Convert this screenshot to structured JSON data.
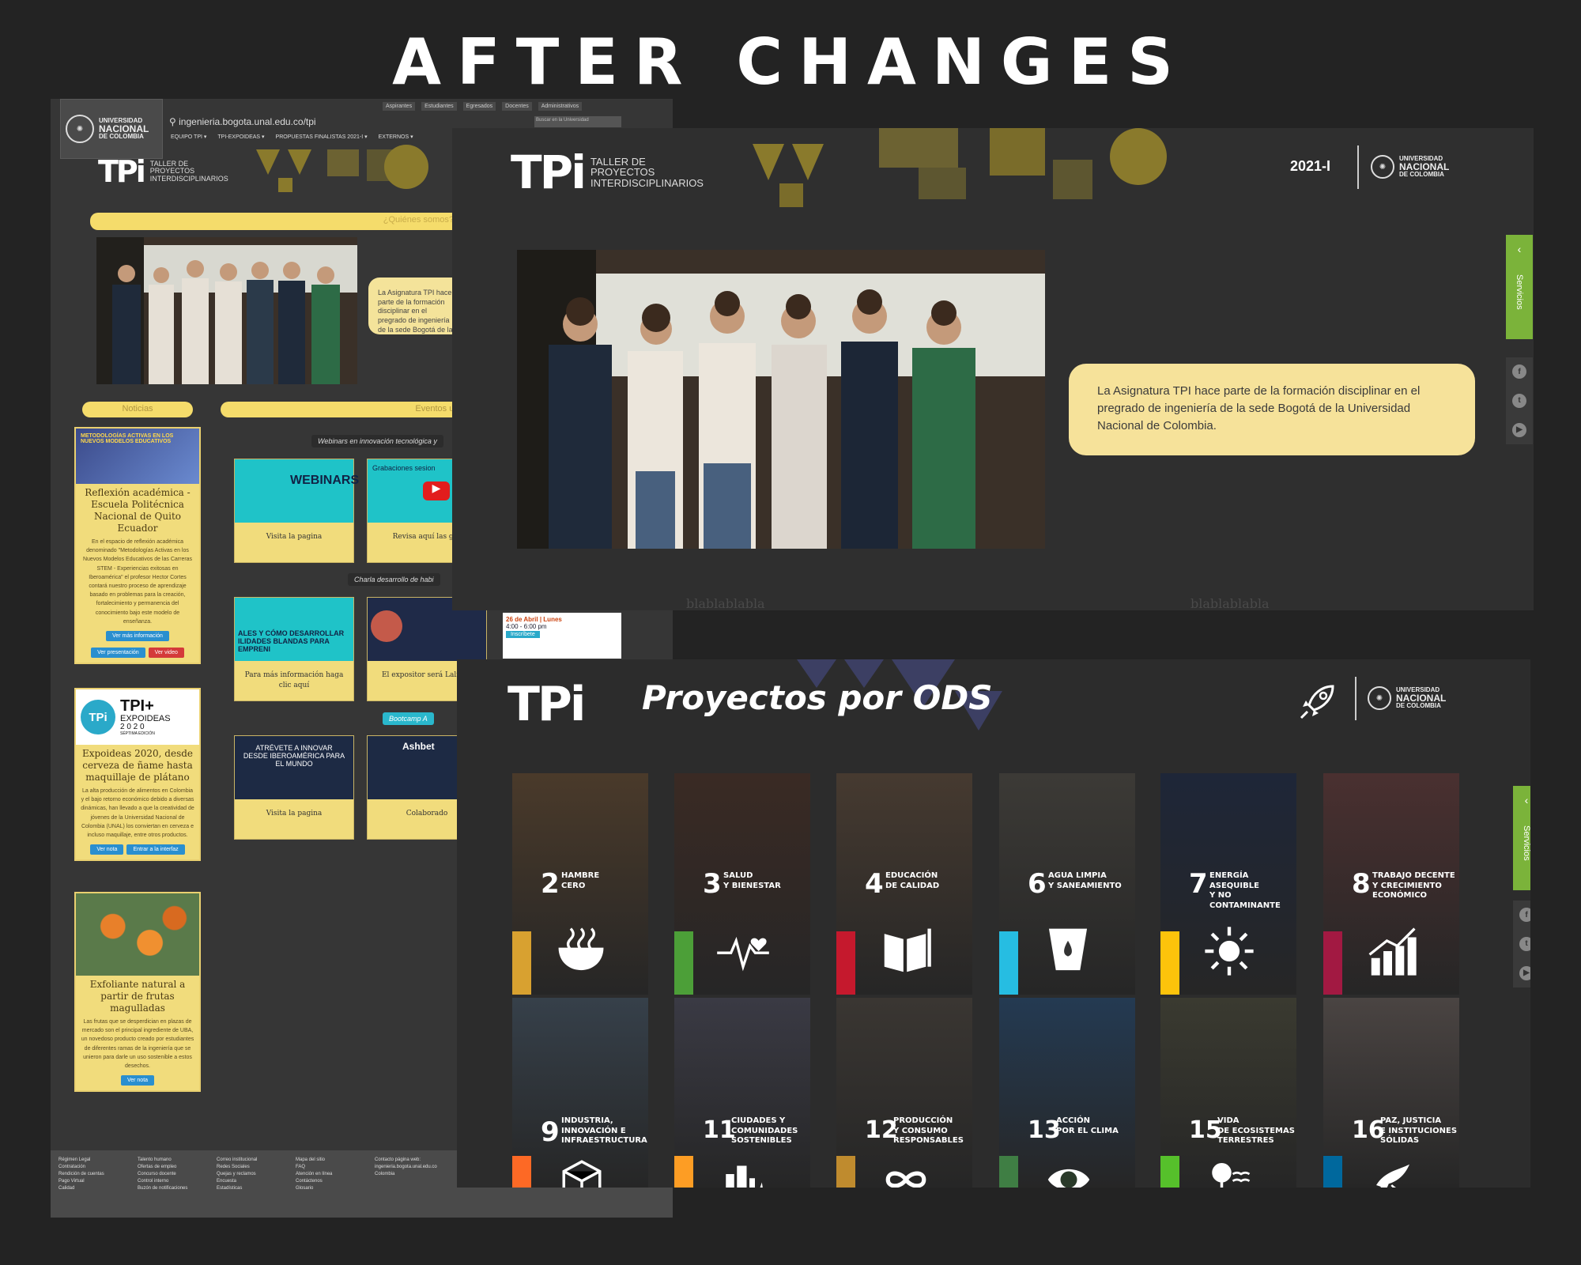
{
  "heading": "AFTER CHANGES",
  "old": {
    "unal_logo": {
      "line1": "UNIVERSIDAD",
      "line2": "NACIONAL",
      "line3": "DE COLOMBIA"
    },
    "top_nav": [
      "Aspirantes",
      "Estudiantes",
      "Egresados",
      "Docentes",
      "Administrativos"
    ],
    "url": "ingenieria.bogota.unal.edu.co/tpi",
    "search_placeholder": "Buscar en la Universidad",
    "menu": [
      "EQUIPO TPI ▾",
      "TPI-EXPOIDEAS ▾",
      "PROPUESTAS FINALISTAS 2021-I ▾",
      "EXTERNOS ▾"
    ],
    "tpi_logo": {
      "mark": "TPi",
      "l1": "Taller de",
      "l2": "Proyectos",
      "l3": "Interdisciplinarios"
    },
    "quienes_label": "¿Quiénes somos?",
    "about_text": "La Asignatura TPI hace parte de la formación disciplinar en el pregrado de ingeniería de la sede Bogotá de la Universidad Nacional de Colombia.",
    "noticias_label": "Noticias",
    "eventos_label": "Eventos unal",
    "news": [
      {
        "title": "Reflexión académica - Escuela Politécnica Nacional de Quito Ecuador",
        "body": "En el espacio de reflexión académica denominado \"Metodologías Activas en los Nuevos Modelos Educativos de las Carreras STEM - Experiencias exitosas en Iberoamérica\" el profesor Hector Cortes contará nuestro proceso de aprendizaje basado en problemas para la creación, fortalecimiento y permanencia del conocimiento bajo este modelo de enseñanza.",
        "btns": [
          "Ver más información",
          "Ver presentación",
          "Ver video"
        ]
      },
      {
        "title": "Expoideas 2020, desde cerveza de ñame hasta maquillaje de plátano",
        "body": "La alta producción de alimentos en Colombia y el bajo retorno económico debido a diversas dinámicas, han llevado a que la creatividad de jóvenes de la Universidad Nacional de Colombia (UNAL) los conviertan en cerveza e incluso maquillaje, entre otros productos.",
        "btns": [
          "Ver nota",
          "Entrar a la interfaz"
        ]
      },
      {
        "title": "Exfoliante natural a partir de frutas magulladas",
        "body": "Las frutas que se desperdician en plazas de mercado son el principal ingrediente de UBA, un novedoso producto creado por estudiantes de diferentes ramas de la ingeniería que se unieron para darle un uso sostenible a estos desechos.",
        "btns": [
          "Ver nota"
        ]
      }
    ],
    "expo_logo": {
      "l1": "TPI+",
      "l2": "EXPOIDEAS",
      "l3": "2 0 2 0",
      "l4": "SÉPTIMA EDICIÓN"
    },
    "section_webinars": "Webinars en innovación tecnológica y",
    "section_charla": "Charla desarrollo de habi",
    "section_bootcamp": "Bootcamp A",
    "events": [
      {
        "caption": "Visita la pagina",
        "img": "WEBINARS"
      },
      {
        "caption": "Revisa aquí las gra",
        "img": "Grabaciones sesion"
      },
      {
        "caption": "Para más información haga clic aquí",
        "img": "ALES Y CÓMO DESARROLLAR ILIDADES BLANDAS PARA EMPRENI"
      },
      {
        "caption": "El expositor será Lalinde",
        "img": ""
      },
      {
        "caption": "Visita la pagina",
        "img": "ATRÉVETE A INNOVAR DESDE IBEROAMÉRICA PARA EL MUNDO"
      },
      {
        "caption": "Colaborado",
        "img": "Ashbet"
      }
    ],
    "promo": {
      "date": "26 de Abril | Lunes",
      "time": "4:00 - 6:00 pm",
      "cta": "Inscríbete"
    },
    "footer": [
      [
        "Régimen Legal",
        "Contratación",
        "Rendición de cuentas",
        "Pago Virtual",
        "Calidad"
      ],
      [
        "Talento humano",
        "Ofertas de empleo",
        "Concurso docente",
        "Control interno",
        "Buzón de notificaciones"
      ],
      [
        "Correo institucional",
        "Redes Sociales",
        "Quejas y reclamos",
        "Encuesta",
        "Estadísticas"
      ],
      [
        "Mapa del sitio",
        "FAQ",
        "Atención en línea",
        "Contáctenos",
        "Glosario"
      ],
      [
        "Contacto página web:",
        "ingenieria.bogota.unal.edu.co",
        "Colombia"
      ]
    ]
  },
  "new1": {
    "tpi_logo": {
      "mark": "TPi",
      "l1": "Taller de",
      "l2": "Proyectos",
      "l3": "Interdisciplinarios"
    },
    "period": "2021-I",
    "unal": {
      "line1": "UNIVERSIDAD",
      "line2": "NACIONAL",
      "line3": "DE COLOMBIA"
    },
    "about_text": "La Asignatura TPI hace parte de la formación disciplinar en el pregrado de ingeniería de la sede Bogotá de la Universidad Nacional de Colombia.",
    "servicios": "Servicios",
    "watermark": "blablablabla"
  },
  "new2": {
    "tpi_mark": "TPi",
    "title": "Proyectos por ODS",
    "unal": {
      "line1": "UNIVERSIDAD",
      "line2": "NACIONAL",
      "line3": "DE COLOMBIA"
    },
    "servicios": "Servicios",
    "ods": [
      {
        "num": "2",
        "label": "HAMBRE\nCERO",
        "color": "#d8a130",
        "icon": "bowl-icon"
      },
      {
        "num": "3",
        "label": "SALUD\nY BIENESTAR",
        "color": "#4c9f38",
        "icon": "heartbeat-icon"
      },
      {
        "num": "4",
        "label": "EDUCACIÓN\nDE CALIDAD",
        "color": "#c5192d",
        "icon": "book-icon"
      },
      {
        "num": "6",
        "label": "AGUA LIMPIA\nY SANEAMIENTO",
        "color": "#26bde2",
        "icon": "water-icon"
      },
      {
        "num": "7",
        "label": "ENERGÍA ASEQUIBLE\nY NO CONTAMINANTE",
        "color": "#fcc30b",
        "icon": "sun-icon"
      },
      {
        "num": "8",
        "label": "TRABAJO DECENTE\nY CRECIMIENTO\nECONÓMICO",
        "color": "#a21942",
        "icon": "growth-chart-icon"
      },
      {
        "num": "9",
        "label": "INDUSTRIA,\nINNOVACIÓN E\nINFRAESTRUCTURA",
        "color": "#fd6925",
        "icon": "cube-icon"
      },
      {
        "num": "11",
        "label": "CIUDADES Y\nCOMUNIDADES\nSOSTENIBLES",
        "color": "#fd9d24",
        "icon": "city-icon"
      },
      {
        "num": "12",
        "label": "PRODUCCIÓN\nY CONSUMO\nRESPONSABLES",
        "color": "#bf8b2e",
        "icon": "infinity-icon"
      },
      {
        "num": "13",
        "label": "ACCIÓN\nPOR EL CLIMA",
        "color": "#3f7e44",
        "icon": "eye-globe-icon"
      },
      {
        "num": "15",
        "label": "VIDA\nDE ECOSISTEMAS\nTERRESTRES",
        "color": "#56c02b",
        "icon": "tree-icon"
      },
      {
        "num": "16",
        "label": "PAZ, JUSTICIA\nE INSTITUCIONES\nSÓLIDAS",
        "color": "#00689d",
        "icon": "dove-icon"
      }
    ]
  }
}
